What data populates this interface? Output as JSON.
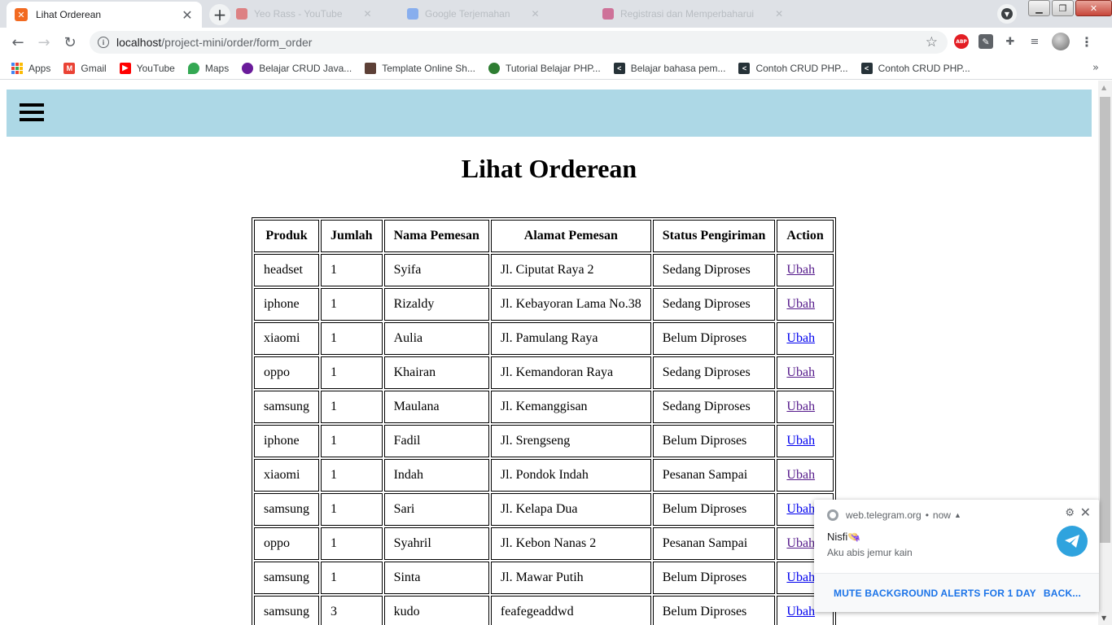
{
  "browser": {
    "tab": {
      "title": "Lihat Orderean",
      "favicon_color": "#f26a21"
    },
    "background_tabs": [
      {
        "title": "Yeo Rass - YouTube"
      },
      {
        "title": "Google Terjemahan"
      },
      {
        "title": "Registrasi dan Memperbaharui"
      }
    ],
    "address": {
      "host": "localhost",
      "path": "/project-mini/order/form_order"
    },
    "bookmarks": [
      {
        "label": "Apps",
        "icon": "apps-grid-icon"
      },
      {
        "label": "Gmail",
        "icon": "gmail-icon",
        "color": "#ea4335"
      },
      {
        "label": "YouTube",
        "icon": "youtube-icon",
        "color": "#ff0000"
      },
      {
        "label": "Maps",
        "icon": "maps-pin-icon",
        "color": "#34a853"
      },
      {
        "label": "Belajar CRUD Java...",
        "icon": "site-icon",
        "color": "#6a1b9a"
      },
      {
        "label": "Template Online Sh...",
        "icon": "site-icon",
        "color": "#5d4037"
      },
      {
        "label": "Tutorial Belajar PHP...",
        "icon": "site-icon",
        "color": "#2e7d32"
      },
      {
        "label": "Belajar bahasa pem...",
        "icon": "codepolitan-icon",
        "color": "#263238"
      },
      {
        "label": "Contoh CRUD PHP...",
        "icon": "codepolitan-icon",
        "color": "#263238"
      },
      {
        "label": "Contoh CRUD PHP...",
        "icon": "codepolitan-icon",
        "color": "#263238"
      }
    ]
  },
  "page": {
    "title": "Lihat Orderean",
    "navbar_color": "#add8e6",
    "table": {
      "headers": [
        "Produk",
        "Jumlah",
        "Nama Pemesan",
        "Alamat Pemesan",
        "Status Pengiriman",
        "Action"
      ],
      "rows": [
        {
          "produk": "headset",
          "jumlah": "1",
          "nama": "Syifa",
          "alamat": "Jl. Ciputat Raya 2",
          "status": "Sedang Diproses",
          "action": "Ubah",
          "visited": true
        },
        {
          "produk": "iphone",
          "jumlah": "1",
          "nama": "Rizaldy",
          "alamat": "Jl. Kebayoran Lama No.38",
          "status": "Sedang Diproses",
          "action": "Ubah",
          "visited": true
        },
        {
          "produk": "xiaomi",
          "jumlah": "1",
          "nama": "Aulia",
          "alamat": "Jl. Pamulang Raya",
          "status": "Belum Diproses",
          "action": "Ubah",
          "visited": false
        },
        {
          "produk": "oppo",
          "jumlah": "1",
          "nama": "Khairan",
          "alamat": "Jl. Kemandoran Raya",
          "status": "Sedang Diproses",
          "action": "Ubah",
          "visited": true
        },
        {
          "produk": "samsung",
          "jumlah": "1",
          "nama": "Maulana",
          "alamat": "Jl. Kemanggisan",
          "status": "Sedang Diproses",
          "action": "Ubah",
          "visited": true
        },
        {
          "produk": "iphone",
          "jumlah": "1",
          "nama": "Fadil",
          "alamat": "Jl. Srengseng",
          "status": "Belum Diproses",
          "action": "Ubah",
          "visited": false
        },
        {
          "produk": "xiaomi",
          "jumlah": "1",
          "nama": "Indah",
          "alamat": "Jl. Pondok Indah",
          "status": "Pesanan Sampai",
          "action": "Ubah",
          "visited": true
        },
        {
          "produk": "samsung",
          "jumlah": "1",
          "nama": "Sari",
          "alamat": "Jl. Kelapa Dua",
          "status": "Belum Diproses",
          "action": "Ubah",
          "visited": false
        },
        {
          "produk": "oppo",
          "jumlah": "1",
          "nama": "Syahril",
          "alamat": "Jl. Kebon Nanas 2",
          "status": "Pesanan Sampai",
          "action": "Ubah",
          "visited": true
        },
        {
          "produk": "samsung",
          "jumlah": "1",
          "nama": "Sinta",
          "alamat": "Jl. Mawar Putih",
          "status": "Belum Diproses",
          "action": "Ubah",
          "visited": false
        },
        {
          "produk": "samsung",
          "jumlah": "3",
          "nama": "kudo",
          "alamat": "feafegeaddwd",
          "status": "Belum Diproses",
          "action": "Ubah",
          "visited": false
        }
      ]
    }
  },
  "notification": {
    "source": "web.telegram.org",
    "time": "now",
    "sender": "Nisfi",
    "message": "Aku abis jemur kain",
    "mute_label": "MUTE BACKGROUND ALERTS FOR 1 DAY",
    "back_label": "BACK...",
    "logo_color": "#2fa3de"
  }
}
